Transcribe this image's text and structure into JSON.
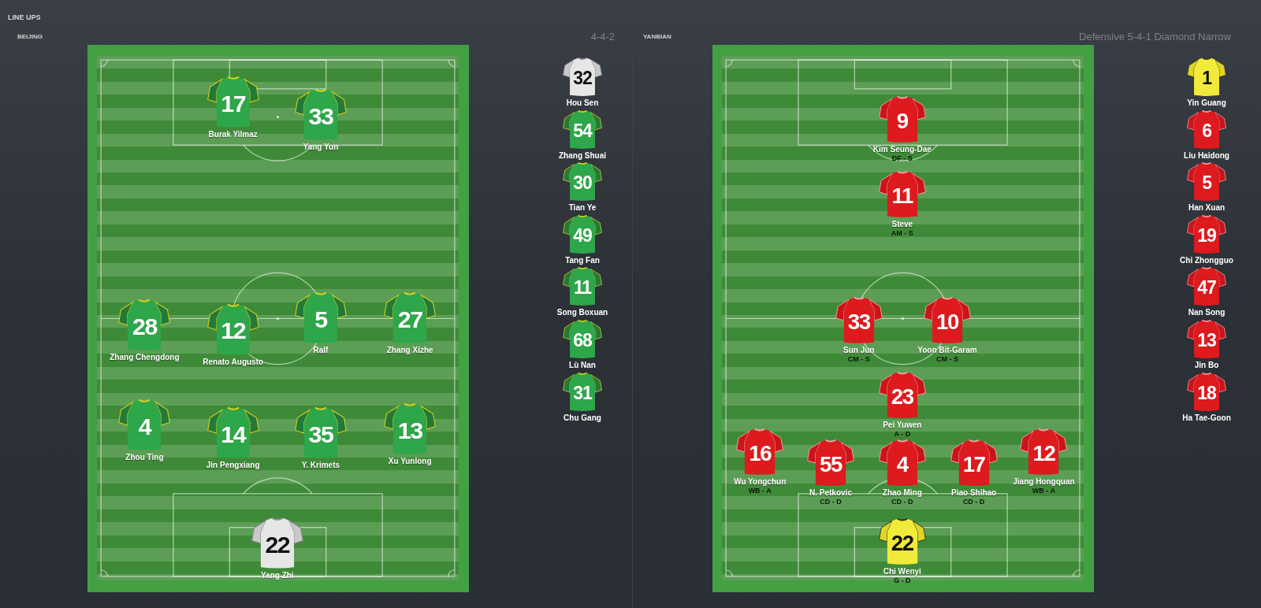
{
  "title": "LINE UPS",
  "teams": [
    {
      "name": "BEIJING",
      "formation": "4-4-2",
      "starters": [
        {
          "number": "17",
          "name": "Burak Yilmaz",
          "color": "#2ea64a"
        },
        {
          "number": "33",
          "name": "Yang Yun",
          "color": "#2ea64a"
        },
        {
          "number": "28",
          "name": "Zhang Chengdong",
          "color": "#2ea64a"
        },
        {
          "number": "12",
          "name": "Renato Augusto",
          "color": "#2ea64a"
        },
        {
          "number": "5",
          "name": "Ralf",
          "color": "#2ea64a"
        },
        {
          "number": "27",
          "name": "Zhang Xizhe",
          "color": "#2ea64a"
        },
        {
          "number": "4",
          "name": "Zhou Ting",
          "color": "#2ea64a"
        },
        {
          "number": "14",
          "name": "Jin Pengxiang",
          "color": "#2ea64a"
        },
        {
          "number": "35",
          "name": "Y. Krimets",
          "color": "#2ea64a"
        },
        {
          "number": "13",
          "name": "Xu Yunlong",
          "color": "#2ea64a"
        },
        {
          "number": "22",
          "name": "Yang Zhi",
          "color": "#e6e6e6"
        }
      ],
      "substitutes": [
        {
          "number": "32",
          "name": "Hou Sen",
          "color": "#e6e6e6"
        },
        {
          "number": "54",
          "name": "Zhang Shuai",
          "color": "#2ea64a"
        },
        {
          "number": "30",
          "name": "Tian Ye",
          "color": "#2ea64a"
        },
        {
          "number": "49",
          "name": "Tang Fan",
          "color": "#2ea64a"
        },
        {
          "number": "11",
          "name": "Song Boxuan",
          "color": "#2ea64a"
        },
        {
          "number": "68",
          "name": "Lù Nan",
          "color": "#2ea64a"
        },
        {
          "number": "31",
          "name": "Chu Gang",
          "color": "#2ea64a"
        }
      ]
    },
    {
      "name": "YANBIAN",
      "formation": "Defensive 5-4-1 Diamond Narrow",
      "starters": [
        {
          "number": "9",
          "name": "Kim Seung-Dae",
          "role": "DF - S",
          "color": "#dd1a1e"
        },
        {
          "number": "11",
          "name": "Steve",
          "role": "AM - S",
          "color": "#dd1a1e"
        },
        {
          "number": "33",
          "name": "Sun Jun",
          "role": "CM - S",
          "color": "#dd1a1e"
        },
        {
          "number": "10",
          "name": "Yoon Bit-Garam",
          "role": "CM - S",
          "color": "#dd1a1e"
        },
        {
          "number": "23",
          "name": "Pei Yuwen",
          "role": "A - D",
          "color": "#dd1a1e"
        },
        {
          "number": "16",
          "name": "Wu Yongchun",
          "role": "WB - A",
          "color": "#dd1a1e"
        },
        {
          "number": "55",
          "name": "N. Petkovic",
          "role": "CD - D",
          "color": "#dd1a1e"
        },
        {
          "number": "4",
          "name": "Zhao Ming",
          "role": "CD - D",
          "color": "#dd1a1e"
        },
        {
          "number": "17",
          "name": "Piao Shihao",
          "role": "CD - D",
          "color": "#dd1a1e"
        },
        {
          "number": "12",
          "name": "Jiang Hongquan",
          "role": "WB - A",
          "color": "#dd1a1e"
        },
        {
          "number": "22",
          "name": "Chi Wenyi",
          "role": "G - D",
          "color": "#f2ea38"
        }
      ],
      "substitutes": [
        {
          "number": "1",
          "name": "Yin Guang",
          "color": "#f2ea38"
        },
        {
          "number": "6",
          "name": "Liu Haidong",
          "color": "#dd1a1e"
        },
        {
          "number": "5",
          "name": "Han Xuan",
          "color": "#dd1a1e"
        },
        {
          "number": "19",
          "name": "Chi Zhongguo",
          "color": "#dd1a1e"
        },
        {
          "number": "47",
          "name": "Nan Song",
          "color": "#dd1a1e"
        },
        {
          "number": "13",
          "name": "Jin Bo",
          "color": "#dd1a1e"
        },
        {
          "number": "18",
          "name": "Ha Tae-Goon",
          "color": "#dd1a1e"
        }
      ]
    }
  ]
}
